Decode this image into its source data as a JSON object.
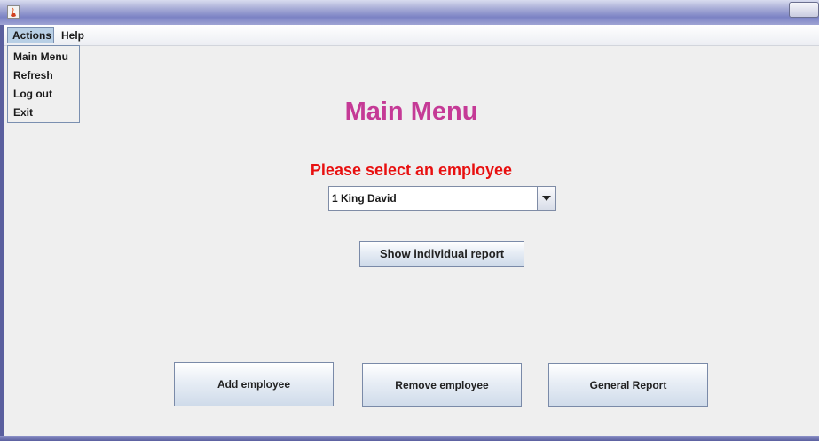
{
  "titlebar": {
    "icon": "java-cup-icon"
  },
  "menubar": {
    "menus": [
      {
        "label": "Actions"
      },
      {
        "label": "Help"
      }
    ]
  },
  "actions_menu": {
    "items": [
      {
        "label": "Main Menu"
      },
      {
        "label": "Refresh"
      },
      {
        "label": "Log out"
      },
      {
        "label": "Exit"
      }
    ]
  },
  "main": {
    "title": "Main Menu",
    "prompt": "Please select an employee",
    "employee_select": {
      "value": "1 King David"
    },
    "report_button": "Show individual report",
    "add_button": "Add employee",
    "remove_button": "Remove employee",
    "general_button": "General Report"
  },
  "colors": {
    "title": "#c53a96",
    "prompt": "#e81010",
    "window_bg": "#efefef"
  }
}
